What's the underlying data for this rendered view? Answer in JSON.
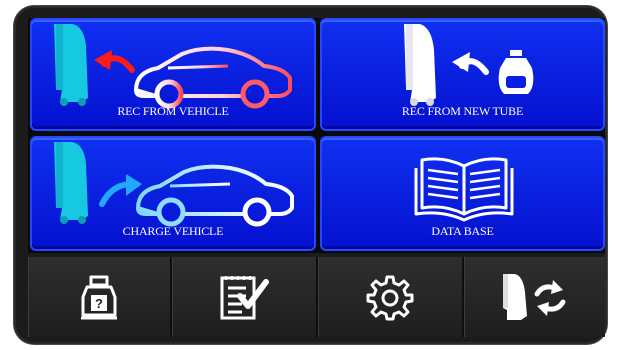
{
  "tiles": [
    {
      "id": "rec-from-vehicle",
      "label": "REC FROM VEHICLE",
      "icon": "recover-from-vehicle-icon"
    },
    {
      "id": "rec-from-new-tube",
      "label": "REC FROM NEW TUBE",
      "icon": "recover-from-tank-icon"
    },
    {
      "id": "charge-vehicle",
      "label": "CHARGE VEHICLE",
      "icon": "charge-vehicle-icon"
    },
    {
      "id": "data-base",
      "label": "DATA BASE",
      "icon": "open-book-icon"
    }
  ],
  "bottom_bar": {
    "buttons": [
      {
        "id": "tank-info",
        "icon": "tank-question-icon"
      },
      {
        "id": "checklist",
        "icon": "checklist-icon"
      },
      {
        "id": "settings",
        "icon": "gear-icon"
      },
      {
        "id": "machine-cycle",
        "icon": "machine-refresh-icon"
      }
    ]
  },
  "colors": {
    "tile_blue": "#0a1ee6",
    "machine_cyan": "#16c8e0",
    "arrow_red": "#ff1a1a",
    "arrow_cyan": "#22a8ff",
    "bezel": "#1b1b1b"
  }
}
